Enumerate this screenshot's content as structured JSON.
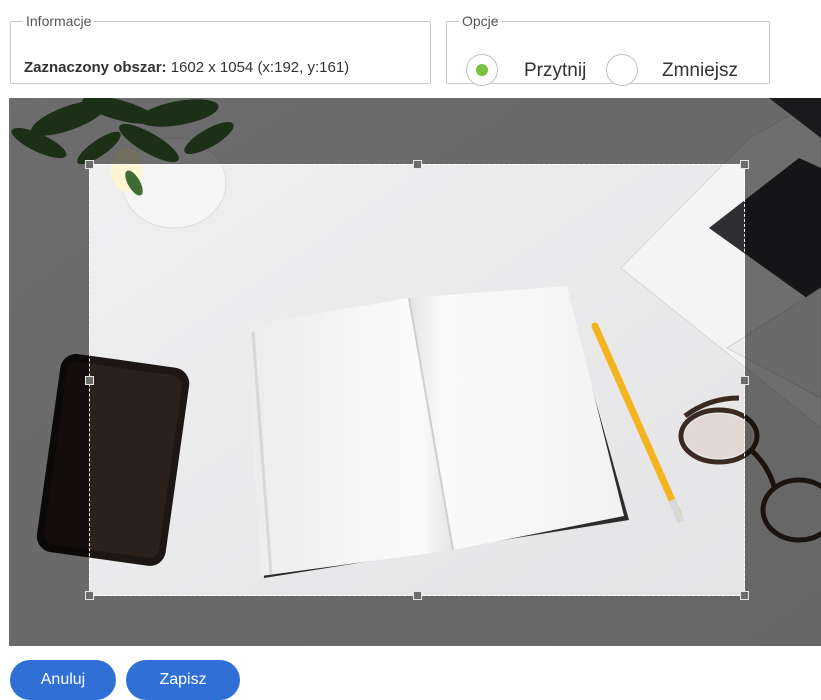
{
  "colors": {
    "accent": "#7ac143",
    "button": "#2f6fd6"
  },
  "info": {
    "legend": "Informacje",
    "label": "Zaznaczony obszar:",
    "value": " 1602 x 1054 (x:192, y:161)"
  },
  "options": {
    "legend": "Opcje",
    "items": [
      {
        "label": "Przytnij",
        "checked": true
      },
      {
        "label": "Zmniejsz",
        "checked": false
      }
    ]
  },
  "actions": {
    "cancel": "Anuluj",
    "save": "Zapisz"
  }
}
